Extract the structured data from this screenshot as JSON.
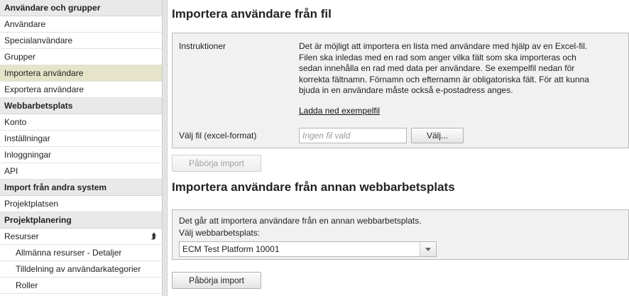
{
  "sidebar": {
    "sections": [
      {
        "title": "Användare och grupper",
        "items": [
          "Användare",
          "Specialanvändare",
          "Grupper",
          "Importera användare",
          "Exportera användare"
        ]
      },
      {
        "title": "Webbarbetsplats",
        "items": [
          "Konto",
          "Inställningar",
          "Inloggningar",
          "API"
        ]
      },
      {
        "title": "Import från andra system",
        "items": [
          "Projektplatsen"
        ]
      },
      {
        "title": "Projektplanering",
        "items": [
          "Resurser"
        ],
        "subitems": [
          "Allmänna resurser - Detaljer",
          "Tilldelning av användarkategorier",
          "Roller"
        ]
      }
    ],
    "collapse_icon": "double-chevron-up-icon"
  },
  "main": {
    "import_file": {
      "title": "Importera användare från fil",
      "instructions_label": "Instruktioner",
      "instructions_text": "Det är möjligt att importera en lista med användare med hjälp av en Excel-fil. Filen ska inledas med en rad som anger vilka fält som ska importeras och sedan innehålla en rad med data per användare. Se exempelfil nedan för korrekta fältnamn. Förnamn och efternamn är obligatoriska fält. För att kunna bjuda in en användare måste också e-postadress anges.",
      "download_link": "Ladda ned exempelfil",
      "file_label": "Välj fil (excel-format)",
      "file_placeholder": "Ingen fil vald",
      "choose_button": "Välj...",
      "start_button": "Påbörja import"
    },
    "import_workspace": {
      "title": "Importera användare från annan webbarbetsplats",
      "description": "Det går att importera användare från en annan webbarbetsplats.",
      "select_label": "Välj webbarbetsplats:",
      "selected_value": "ECM Test Platform 10001",
      "start_button": "Påbörja import"
    }
  }
}
